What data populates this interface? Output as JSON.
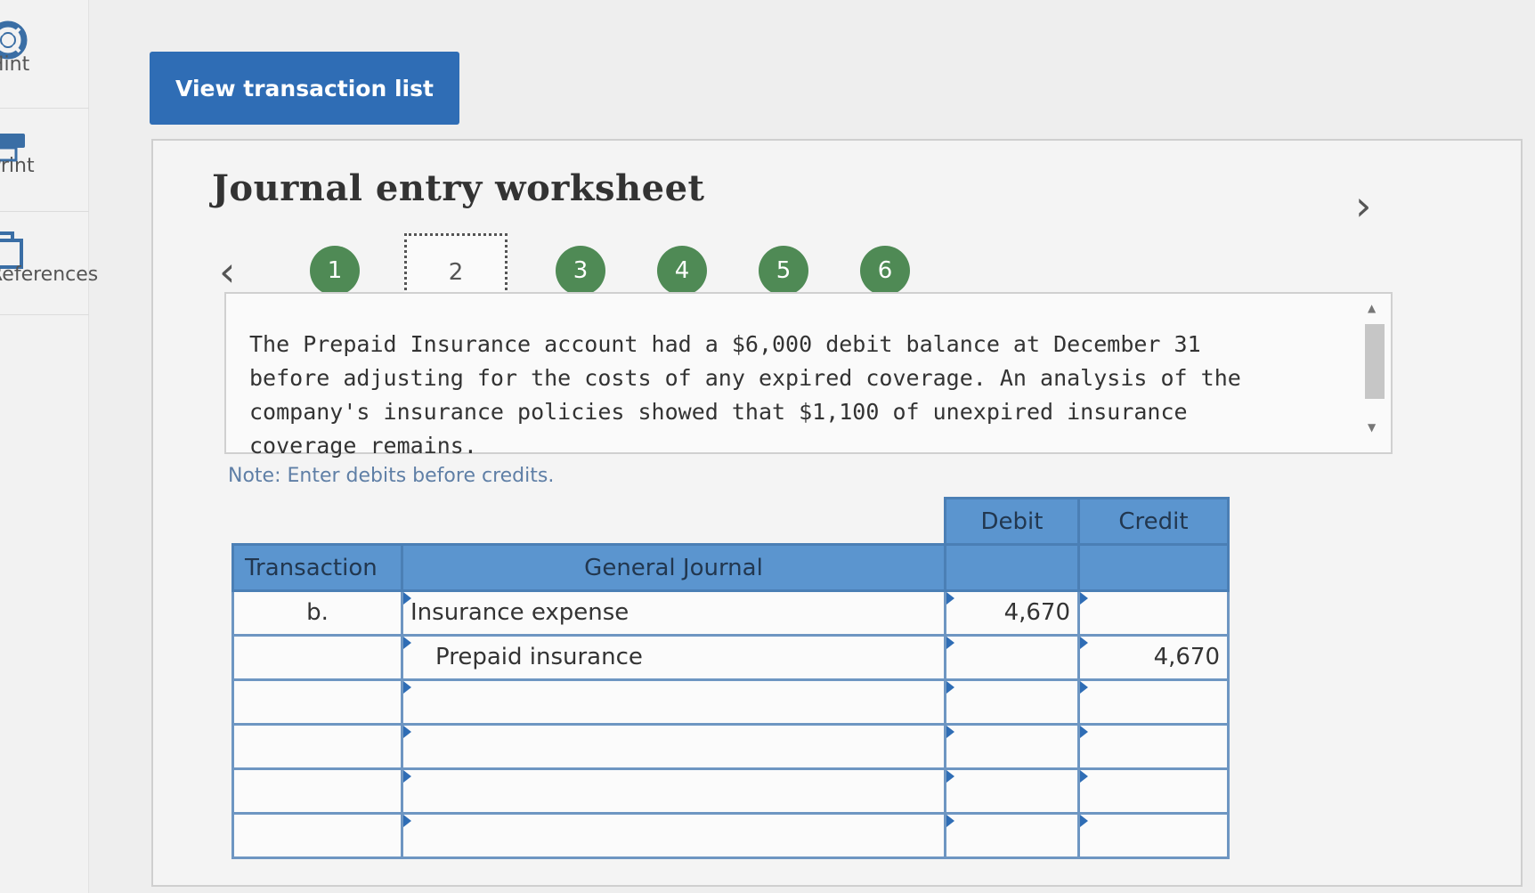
{
  "sidebar": {
    "items": [
      {
        "label": "Hint",
        "icon": "lifebuoy-icon"
      },
      {
        "label": "Print",
        "icon": "printer-icon"
      },
      {
        "label": "References",
        "icon": "copy-icon"
      }
    ]
  },
  "toolbar": {
    "view_transactions_label": "View transaction list"
  },
  "worksheet": {
    "title": "Journal entry worksheet",
    "steps": [
      "1",
      "2",
      "3",
      "4",
      "5",
      "6"
    ],
    "active_step": "2",
    "description": "The Prepaid Insurance account had a $6,000 debit balance at December 31 before adjusting for the costs of any expired coverage. An analysis of the company's insurance policies showed that $1,100 of unexpired insurance coverage remains.",
    "note": "Note: Enter debits before credits."
  },
  "journal": {
    "headers": {
      "transaction": "Transaction",
      "general_journal": "General Journal",
      "debit": "Debit",
      "credit": "Credit"
    },
    "rows": [
      {
        "transaction": "b.",
        "account": "Insurance expense",
        "debit": "4,670",
        "credit": ""
      },
      {
        "transaction": "",
        "account": "Prepaid insurance",
        "debit": "",
        "credit": "4,670"
      },
      {
        "transaction": "",
        "account": "",
        "debit": "",
        "credit": ""
      },
      {
        "transaction": "",
        "account": "",
        "debit": "",
        "credit": ""
      },
      {
        "transaction": "",
        "account": "",
        "debit": "",
        "credit": ""
      },
      {
        "transaction": "",
        "account": "",
        "debit": "",
        "credit": ""
      }
    ]
  },
  "colors": {
    "accent": "#2f6db5",
    "step_complete": "#4f8a55",
    "table_header": "#5b95cf"
  }
}
